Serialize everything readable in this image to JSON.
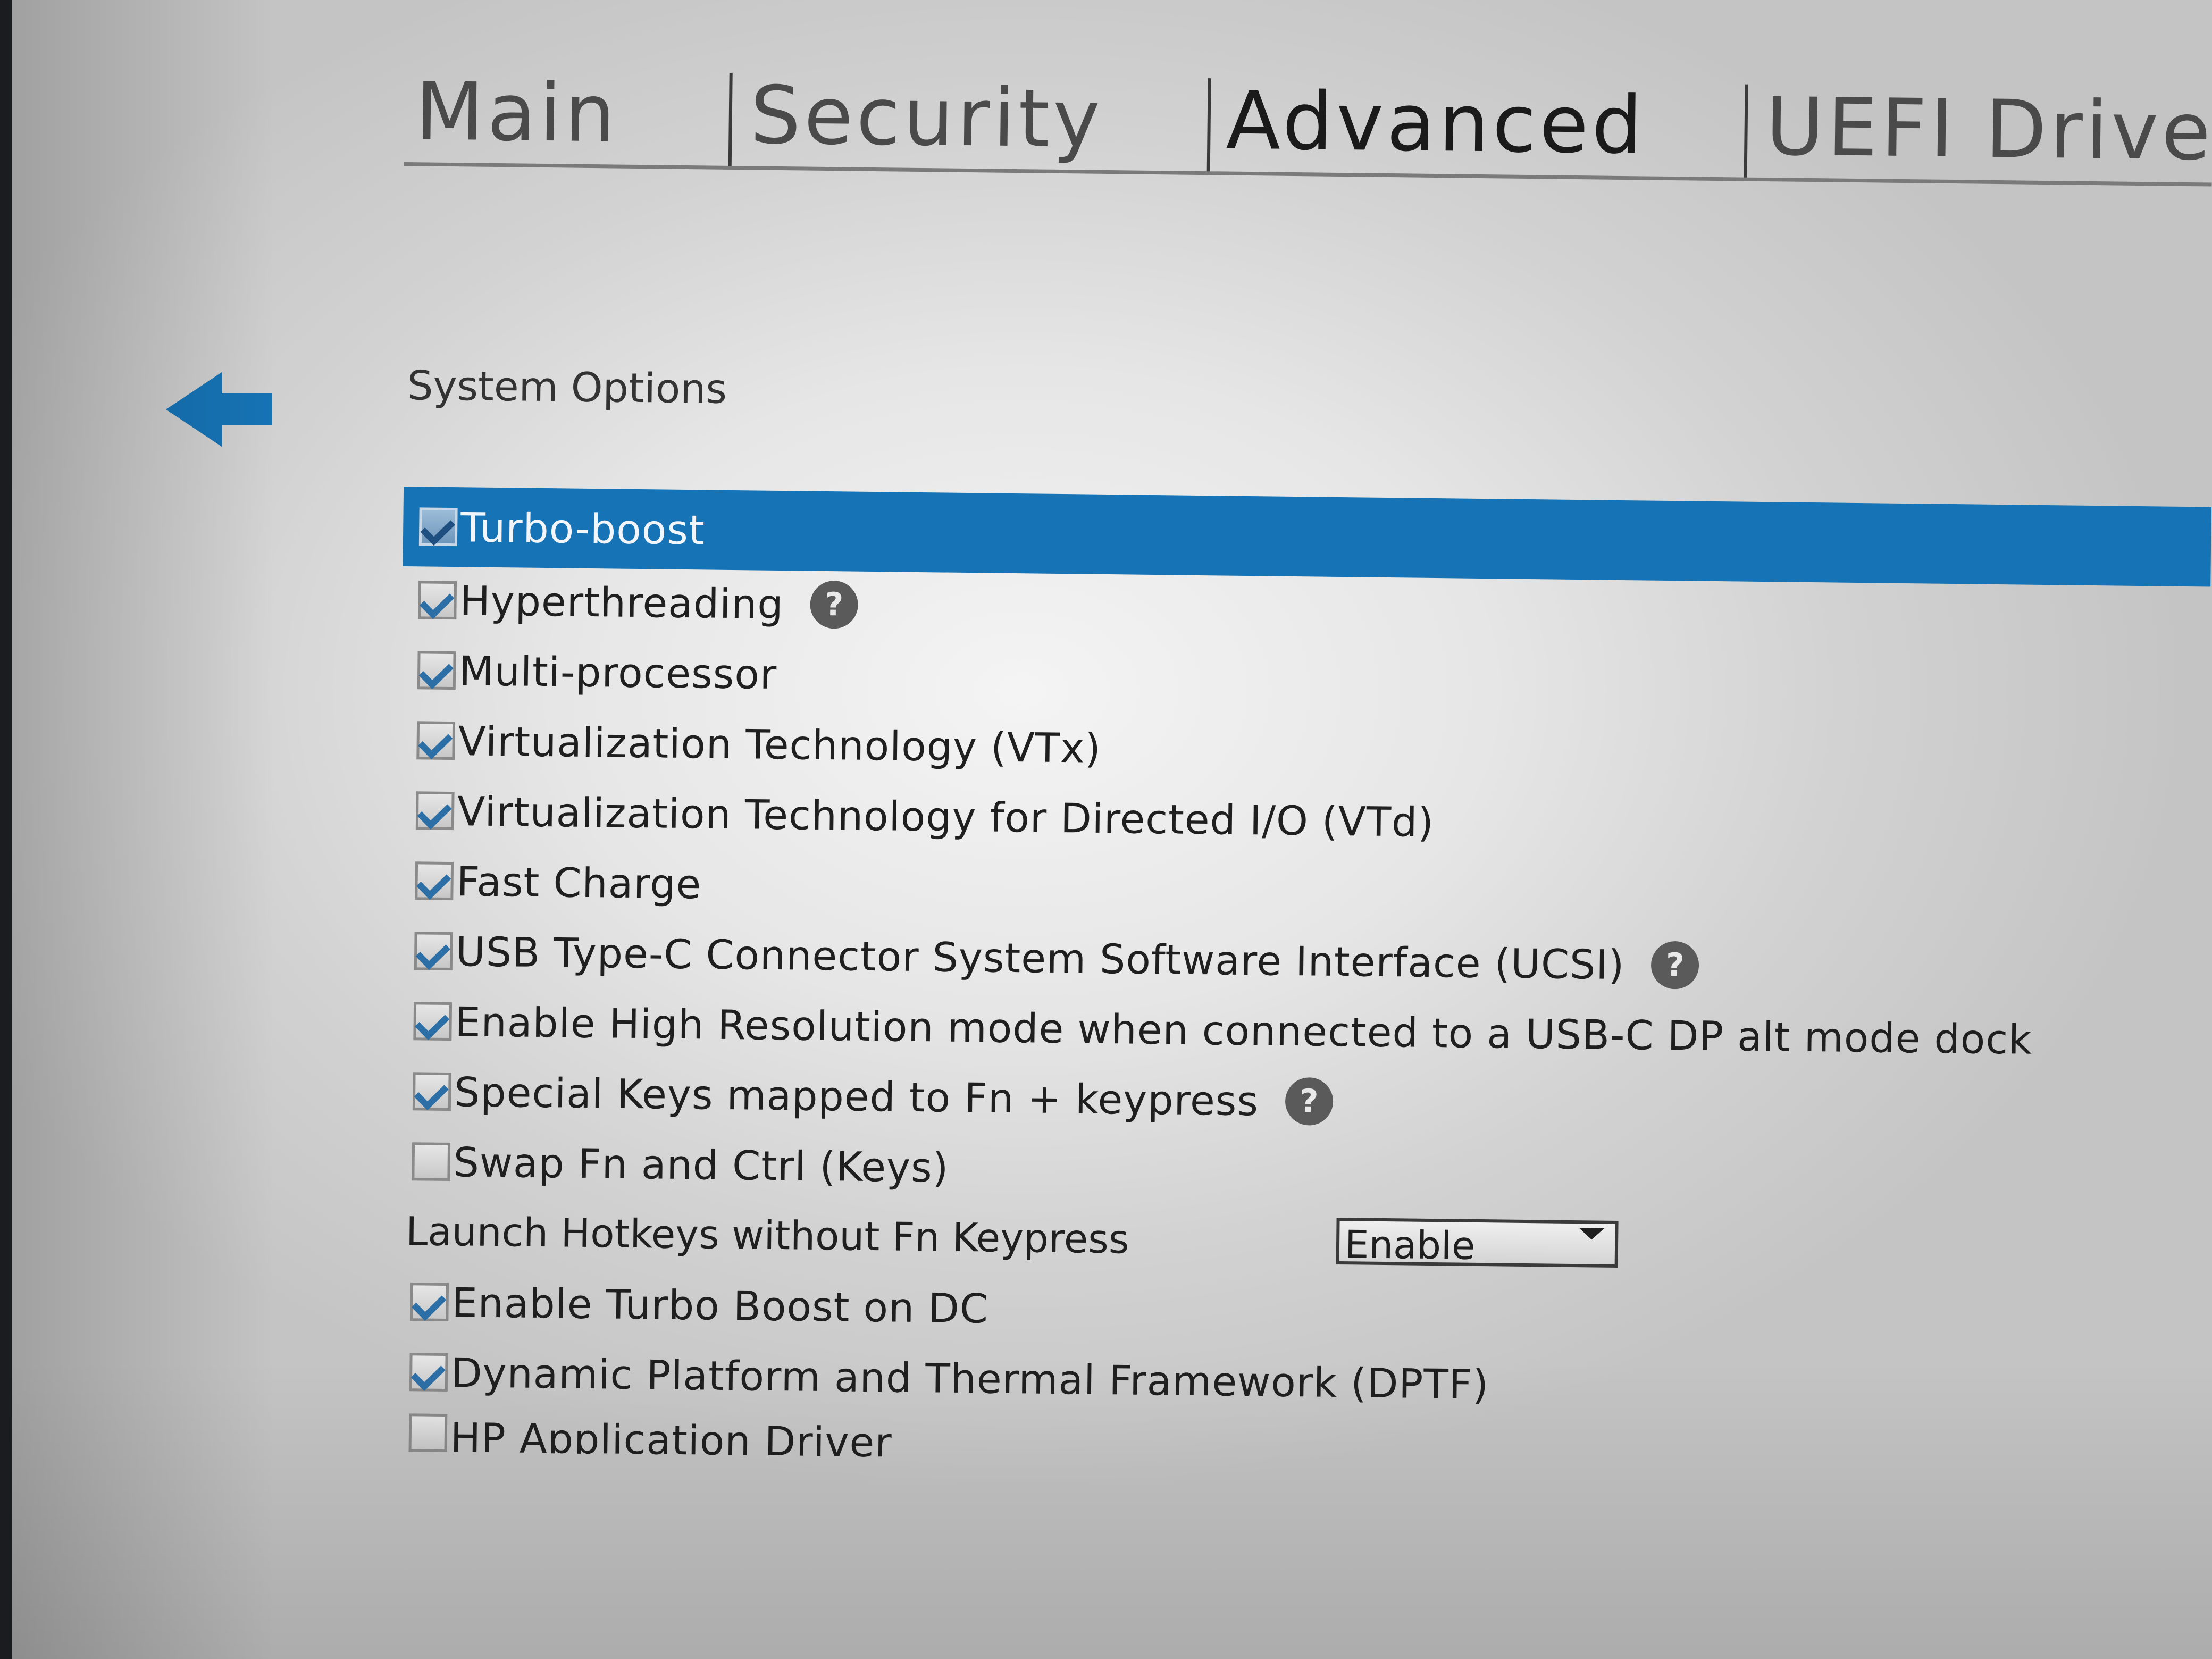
{
  "tabs": [
    {
      "label": "Main"
    },
    {
      "label": "Security"
    },
    {
      "label": "Advanced"
    },
    {
      "label": "UEFI Drivers"
    }
  ],
  "section_title": "System Options",
  "options": [
    {
      "label": "Turbo-boost",
      "checked": true,
      "selected": true,
      "help": false
    },
    {
      "label": "Hyperthreading",
      "checked": true,
      "help": true
    },
    {
      "label": "Multi-processor",
      "checked": true,
      "help": false
    },
    {
      "label": "Virtualization Technology (VTx)",
      "checked": true,
      "help": false
    },
    {
      "label": "Virtualization Technology for Directed I/O (VTd)",
      "checked": true,
      "help": false
    },
    {
      "label": "Fast Charge",
      "checked": true,
      "help": false
    },
    {
      "label": "USB Type-C Connector System Software Interface (UCSI)",
      "checked": true,
      "help": true
    },
    {
      "label": "Enable High Resolution mode when connected to a USB-C DP alt mode dock",
      "checked": true,
      "help": false
    },
    {
      "label": "Special Keys mapped to Fn + keypress",
      "checked": true,
      "help": true
    },
    {
      "label": "Swap Fn and Ctrl (Keys)",
      "checked": false,
      "help": false
    }
  ],
  "hotkeys": {
    "label": "Launch Hotkeys without Fn Keypress",
    "value": "Enable"
  },
  "options_after": [
    {
      "label": "Enable Turbo Boost on DC",
      "checked": true,
      "help": false
    },
    {
      "label": "Dynamic Platform and Thermal Framework (DPTF)",
      "checked": true,
      "help": false
    },
    {
      "label": "HP Application Driver",
      "checked": false,
      "help": false
    }
  ],
  "help_glyph": "?",
  "colors": {
    "highlight": "#1673b5",
    "check": "#2c6fa6",
    "back_arrow": "#1673b5"
  }
}
